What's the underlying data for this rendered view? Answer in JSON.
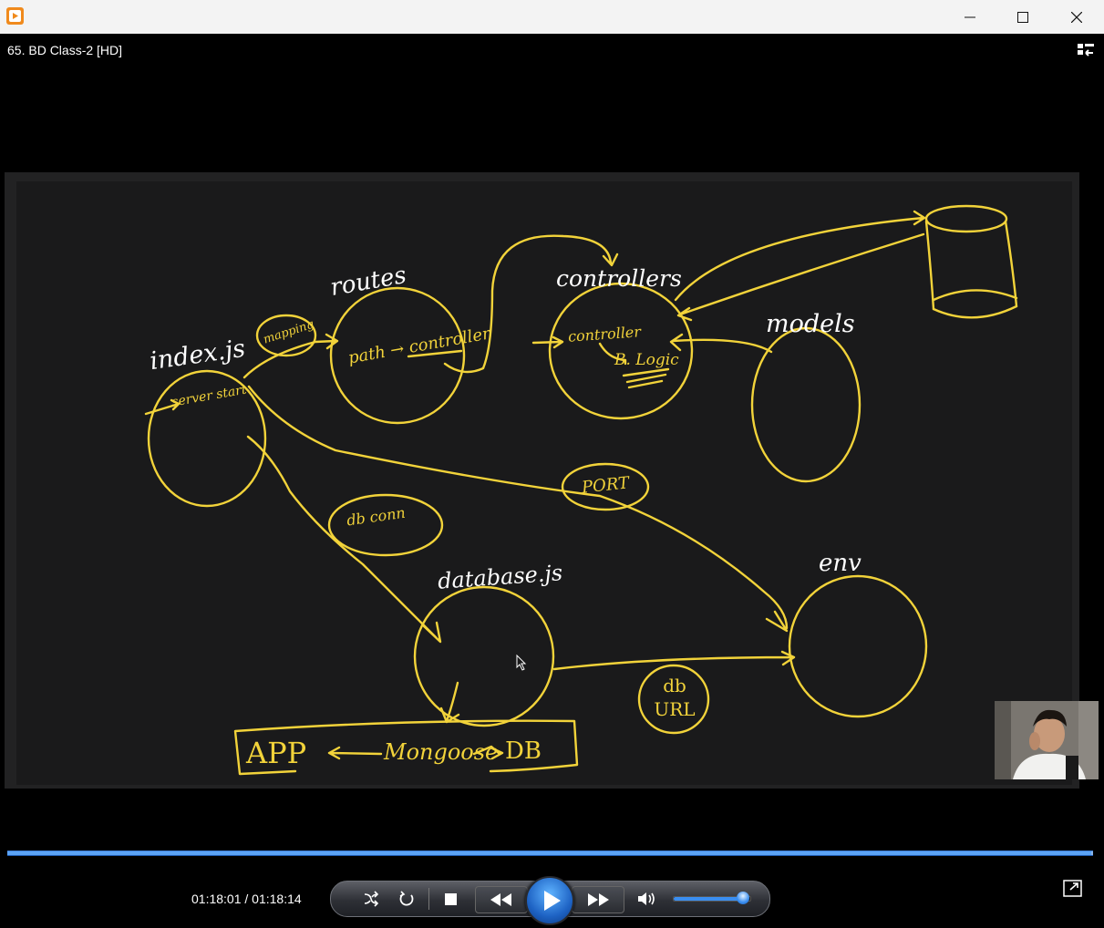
{
  "window": {
    "minimize_icon": "minimize-icon",
    "maximize_icon": "maximize-icon",
    "close_icon": "close-icon"
  },
  "player": {
    "title": "65. BD Class-2 [HD]",
    "time": "01:18:01 / 01:18:14",
    "progress_fraction": 0.998,
    "volume_fraction": 0.9,
    "accent_color": "#3a8ef0"
  },
  "whiteboard": {
    "ink_color": "#f2d33a",
    "labels": {
      "index": "index.js",
      "server_start": "server start",
      "routes": "routes",
      "mapping": "mapping",
      "path_controller": "path → controller",
      "controllers": "controllers",
      "controller": "controller",
      "b_logic": "B. Logic",
      "models": "models",
      "port": "PORT",
      "db_conn": "db conn",
      "database_js": "database.js",
      "env": "env",
      "db_url": "db URL",
      "app": "APP",
      "mongoose": "Mongoose",
      "db": "DB"
    }
  }
}
